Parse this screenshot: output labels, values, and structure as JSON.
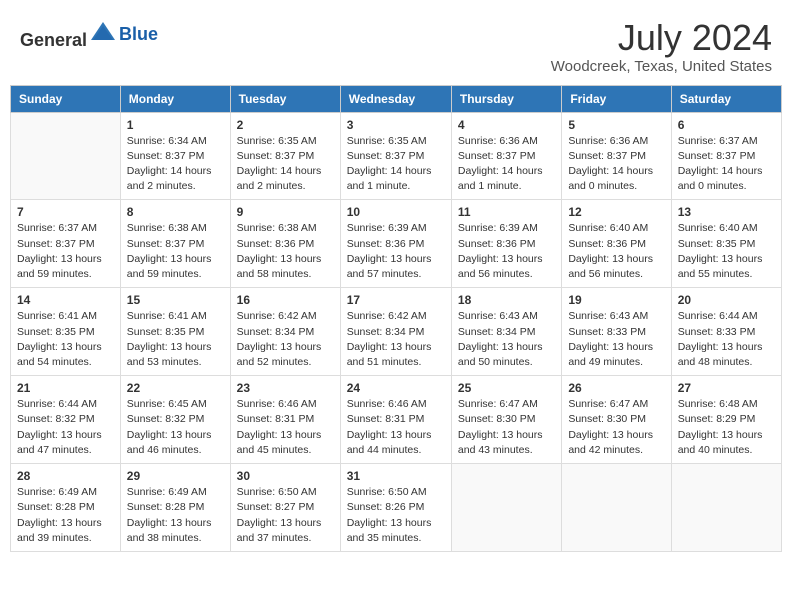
{
  "header": {
    "logo_general": "General",
    "logo_blue": "Blue",
    "month_year": "July 2024",
    "location": "Woodcreek, Texas, United States"
  },
  "days_of_week": [
    "Sunday",
    "Monday",
    "Tuesday",
    "Wednesday",
    "Thursday",
    "Friday",
    "Saturday"
  ],
  "weeks": [
    [
      {
        "day": "",
        "info": ""
      },
      {
        "day": "1",
        "info": "Sunrise: 6:34 AM\nSunset: 8:37 PM\nDaylight: 14 hours\nand 2 minutes."
      },
      {
        "day": "2",
        "info": "Sunrise: 6:35 AM\nSunset: 8:37 PM\nDaylight: 14 hours\nand 2 minutes."
      },
      {
        "day": "3",
        "info": "Sunrise: 6:35 AM\nSunset: 8:37 PM\nDaylight: 14 hours\nand 1 minute."
      },
      {
        "day": "4",
        "info": "Sunrise: 6:36 AM\nSunset: 8:37 PM\nDaylight: 14 hours\nand 1 minute."
      },
      {
        "day": "5",
        "info": "Sunrise: 6:36 AM\nSunset: 8:37 PM\nDaylight: 14 hours\nand 0 minutes."
      },
      {
        "day": "6",
        "info": "Sunrise: 6:37 AM\nSunset: 8:37 PM\nDaylight: 14 hours\nand 0 minutes."
      }
    ],
    [
      {
        "day": "7",
        "info": "Sunrise: 6:37 AM\nSunset: 8:37 PM\nDaylight: 13 hours\nand 59 minutes."
      },
      {
        "day": "8",
        "info": "Sunrise: 6:38 AM\nSunset: 8:37 PM\nDaylight: 13 hours\nand 59 minutes."
      },
      {
        "day": "9",
        "info": "Sunrise: 6:38 AM\nSunset: 8:36 PM\nDaylight: 13 hours\nand 58 minutes."
      },
      {
        "day": "10",
        "info": "Sunrise: 6:39 AM\nSunset: 8:36 PM\nDaylight: 13 hours\nand 57 minutes."
      },
      {
        "day": "11",
        "info": "Sunrise: 6:39 AM\nSunset: 8:36 PM\nDaylight: 13 hours\nand 56 minutes."
      },
      {
        "day": "12",
        "info": "Sunrise: 6:40 AM\nSunset: 8:36 PM\nDaylight: 13 hours\nand 56 minutes."
      },
      {
        "day": "13",
        "info": "Sunrise: 6:40 AM\nSunset: 8:35 PM\nDaylight: 13 hours\nand 55 minutes."
      }
    ],
    [
      {
        "day": "14",
        "info": "Sunrise: 6:41 AM\nSunset: 8:35 PM\nDaylight: 13 hours\nand 54 minutes."
      },
      {
        "day": "15",
        "info": "Sunrise: 6:41 AM\nSunset: 8:35 PM\nDaylight: 13 hours\nand 53 minutes."
      },
      {
        "day": "16",
        "info": "Sunrise: 6:42 AM\nSunset: 8:34 PM\nDaylight: 13 hours\nand 52 minutes."
      },
      {
        "day": "17",
        "info": "Sunrise: 6:42 AM\nSunset: 8:34 PM\nDaylight: 13 hours\nand 51 minutes."
      },
      {
        "day": "18",
        "info": "Sunrise: 6:43 AM\nSunset: 8:34 PM\nDaylight: 13 hours\nand 50 minutes."
      },
      {
        "day": "19",
        "info": "Sunrise: 6:43 AM\nSunset: 8:33 PM\nDaylight: 13 hours\nand 49 minutes."
      },
      {
        "day": "20",
        "info": "Sunrise: 6:44 AM\nSunset: 8:33 PM\nDaylight: 13 hours\nand 48 minutes."
      }
    ],
    [
      {
        "day": "21",
        "info": "Sunrise: 6:44 AM\nSunset: 8:32 PM\nDaylight: 13 hours\nand 47 minutes."
      },
      {
        "day": "22",
        "info": "Sunrise: 6:45 AM\nSunset: 8:32 PM\nDaylight: 13 hours\nand 46 minutes."
      },
      {
        "day": "23",
        "info": "Sunrise: 6:46 AM\nSunset: 8:31 PM\nDaylight: 13 hours\nand 45 minutes."
      },
      {
        "day": "24",
        "info": "Sunrise: 6:46 AM\nSunset: 8:31 PM\nDaylight: 13 hours\nand 44 minutes."
      },
      {
        "day": "25",
        "info": "Sunrise: 6:47 AM\nSunset: 8:30 PM\nDaylight: 13 hours\nand 43 minutes."
      },
      {
        "day": "26",
        "info": "Sunrise: 6:47 AM\nSunset: 8:30 PM\nDaylight: 13 hours\nand 42 minutes."
      },
      {
        "day": "27",
        "info": "Sunrise: 6:48 AM\nSunset: 8:29 PM\nDaylight: 13 hours\nand 40 minutes."
      }
    ],
    [
      {
        "day": "28",
        "info": "Sunrise: 6:49 AM\nSunset: 8:28 PM\nDaylight: 13 hours\nand 39 minutes."
      },
      {
        "day": "29",
        "info": "Sunrise: 6:49 AM\nSunset: 8:28 PM\nDaylight: 13 hours\nand 38 minutes."
      },
      {
        "day": "30",
        "info": "Sunrise: 6:50 AM\nSunset: 8:27 PM\nDaylight: 13 hours\nand 37 minutes."
      },
      {
        "day": "31",
        "info": "Sunrise: 6:50 AM\nSunset: 8:26 PM\nDaylight: 13 hours\nand 35 minutes."
      },
      {
        "day": "",
        "info": ""
      },
      {
        "day": "",
        "info": ""
      },
      {
        "day": "",
        "info": ""
      }
    ]
  ]
}
